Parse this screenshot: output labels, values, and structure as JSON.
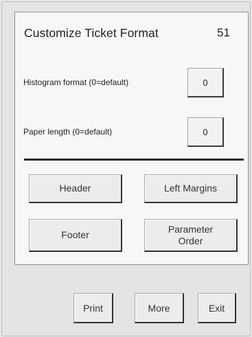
{
  "dialog": {
    "title": "Customize Ticket Format",
    "screen_number": "51"
  },
  "fields": [
    {
      "label": "Histogram format (0=default)",
      "value": "0"
    },
    {
      "label": "Paper length (0=default)",
      "value": "0"
    }
  ],
  "buttons": {
    "header": "Header",
    "left_margins": "Left Margins",
    "footer": "Footer",
    "parameter_order_line1": "Parameter",
    "parameter_order_line2": "Order"
  },
  "footer_buttons": {
    "print": "Print",
    "more": "More",
    "exit": "Exit"
  }
}
